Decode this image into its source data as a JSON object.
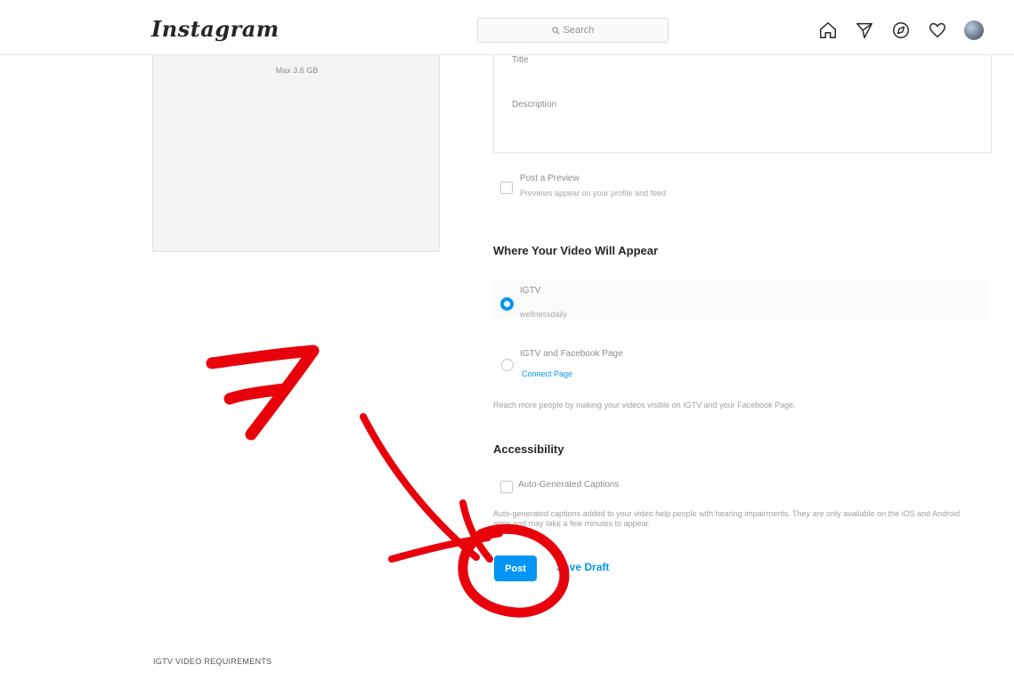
{
  "header": {
    "logo": "Instagram",
    "search_placeholder": "Search",
    "icons": [
      "home-icon",
      "direct-icon",
      "explore-icon",
      "activity-heart-icon",
      "profile-avatar"
    ]
  },
  "upload": {
    "line1": "",
    "line2": "Max 3.6 GB"
  },
  "form": {
    "title_placeholder": "Title",
    "description_placeholder": "Description",
    "preview": {
      "label": "Post a Preview",
      "sub": "Previews appear on your profile and feed"
    },
    "where_heading": "Where Your Video Will Appear",
    "options": [
      {
        "label": "IGTV",
        "sub": "wellnessdaily",
        "selected": true
      },
      {
        "label": "IGTV and Facebook Page",
        "link": "Connect Page",
        "selected": false
      }
    ],
    "reach_note": "Reach more people by making your videos visible on IGTV and your Facebook Page.",
    "accessibility_heading": "Accessibility",
    "captions_label": "Auto-Generated Captions",
    "captions_note": "Auto-generated captions added to your video help people with hearing impairments. They are only available on the iOS and Android apps and may take a few minutes to appear.",
    "post_button": "Post",
    "draft_button": "Save Draft"
  },
  "footer": {
    "requirements": "IGTV VIDEO REQUIREMENTS"
  },
  "annotation": {
    "step_number": "7",
    "color": "#e8000a"
  },
  "colors": {
    "accent": "#0095f6"
  }
}
